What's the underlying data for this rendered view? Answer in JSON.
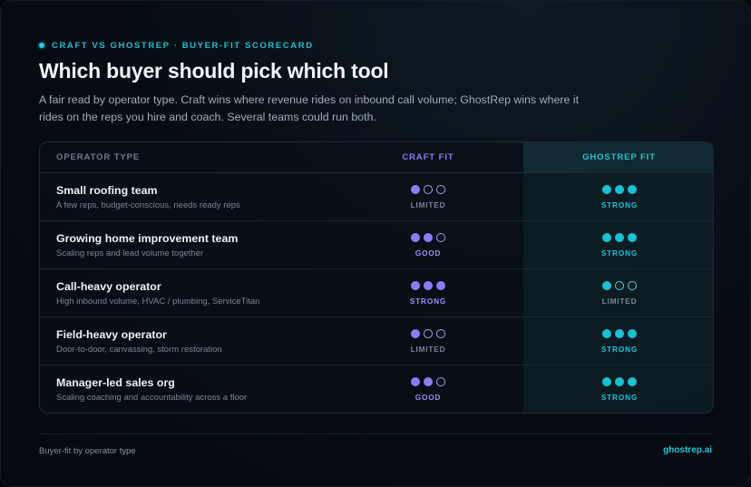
{
  "eyebrow": "CRAFT VS GHOSTREP · BUYER-FIT SCORECARD",
  "title": "Which buyer should pick which tool",
  "subtitle": "A fair read by operator type. Craft wins where revenue rides on inbound call volume; GhostRep wins where it rides on the reps you hire and coach. Several teams could run both.",
  "table": {
    "headers": {
      "type": "OPERATOR TYPE",
      "craft": "CRAFT FIT",
      "ghost": "GHOSTREP FIT"
    },
    "rows": [
      {
        "name": "Small roofing team",
        "desc": "A few reps, budget-conscious, needs ready reps",
        "craft": {
          "score": 1,
          "label": "LIMITED"
        },
        "ghost": {
          "score": 3,
          "label": "STRONG"
        }
      },
      {
        "name": "Growing home improvement team",
        "desc": "Scaling reps and lead volume together",
        "craft": {
          "score": 2,
          "label": "GOOD"
        },
        "ghost": {
          "score": 3,
          "label": "STRONG"
        }
      },
      {
        "name": "Call-heavy operator",
        "desc": "High inbound volume, HVAC / plumbing, ServiceTitan",
        "craft": {
          "score": 3,
          "label": "STRONG"
        },
        "ghost": {
          "score": 1,
          "label": "LIMITED"
        }
      },
      {
        "name": "Field-heavy operator",
        "desc": "Door-to-door, canvassing, storm restoration",
        "craft": {
          "score": 1,
          "label": "LIMITED"
        },
        "ghost": {
          "score": 3,
          "label": "STRONG"
        }
      },
      {
        "name": "Manager-led sales org",
        "desc": "Scaling coaching and accountability across a floor",
        "craft": {
          "score": 2,
          "label": "GOOD"
        },
        "ghost": {
          "score": 3,
          "label": "STRONG"
        }
      }
    ]
  },
  "footer": {
    "left": "Buyer-fit by operator type",
    "right": "ghostrep.ai"
  },
  "colors": {
    "craft_accent": "#8b7cf6",
    "ghost_accent": "#14c3d4",
    "background": "#070c13"
  }
}
